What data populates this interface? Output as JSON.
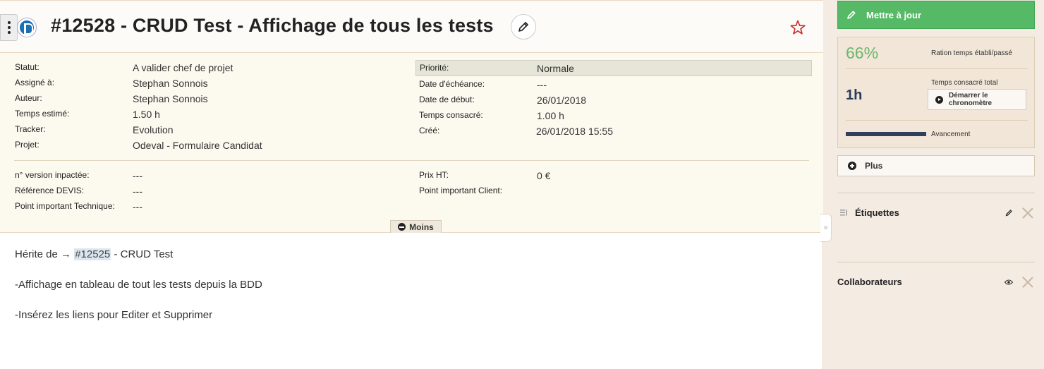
{
  "issue": {
    "title": "#12528 - CRUD Test - Affichage de tous les tests",
    "attributes_left": [
      {
        "label": "Statut:",
        "value": "A valider chef de projet"
      },
      {
        "label": "Assigné à:",
        "value": "Stephan Sonnois"
      },
      {
        "label": "Auteur:",
        "value": "Stephan Sonnois"
      },
      {
        "label": "Temps estimé:",
        "value": "1.50 h"
      },
      {
        "label": "Tracker:",
        "value": "Evolution"
      },
      {
        "label": "Projet:",
        "value": "Odeval - Formulaire Candidat"
      }
    ],
    "attributes_right": [
      {
        "label": "Priorité:",
        "value": "Normale"
      },
      {
        "label": "Date d'échéance:",
        "value": "---"
      },
      {
        "label": "Date de début:",
        "value": "26/01/2018"
      },
      {
        "label": "Temps consacré:",
        "value": "1.00 h"
      },
      {
        "label": "Créé:",
        "value": "26/01/2018 15:55"
      }
    ],
    "custom_left": [
      {
        "label": "n° version inpactée:",
        "value": "---"
      },
      {
        "label": "Référence DEVIS:",
        "value": "---"
      },
      {
        "label": "Point important Technique:",
        "value": "---"
      }
    ],
    "custom_right": [
      {
        "label": "Prix HT:",
        "value": "0 €"
      },
      {
        "label": "Point important Client:",
        "value": ""
      }
    ],
    "toggle_label": "Moins",
    "description": {
      "inherits_prefix": "Hérite de  →",
      "inherits_link": "#12525",
      "inherits_suffix": " - CRUD Test",
      "line2": "-Affichage en tableau de tout les tests depuis la BDD",
      "line3": "-Insérez les liens pour Editer et Supprimer"
    },
    "collapse_glyph": "»"
  },
  "sidebar": {
    "update_label": "Mettre à jour",
    "ratio_value": "66%",
    "ratio_label": "Ration temps établi/passé",
    "time_spent_label": "Temps consacré total",
    "time_spent_value": "1h",
    "chrono_label_1": "Démarrer le",
    "chrono_label_2": "chronomètre",
    "progress_label": "Avancement",
    "progress_fraction": 0.4,
    "more_label": "Plus",
    "tags_title": "Étiquettes",
    "watchers_title": "Collaborateurs"
  },
  "colors": {
    "update_green": "#55b966",
    "ratio_green": "#6ab86a",
    "star_red": "#c9302c",
    "progress_navy": "#2f3f5c"
  },
  "icons": [
    "menu-icon",
    "project-logo-icon",
    "pencil-icon",
    "star-icon",
    "minus-circle-icon",
    "play-icon",
    "plus-circle-icon",
    "tag-list-icon",
    "eye-icon",
    "close-icon"
  ]
}
